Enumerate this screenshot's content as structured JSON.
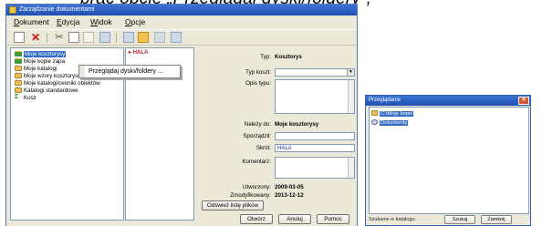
{
  "heading": "brać opcję „Przeglądaj dyski/foldery”,",
  "main_window": {
    "title": "Zarządzanie dokumentami",
    "menu": [
      "Dokument",
      "Edycja",
      "Widok",
      "Opcje"
    ],
    "tree": {
      "items": [
        {
          "label": "Moje kosztorysy",
          "icon": "green-folder-icon",
          "selected": true
        },
        {
          "label": "Moje kopie zapa",
          "icon": "green-folder-icon",
          "selected": false
        },
        {
          "label": "Moje katalogi",
          "icon": "folder-icon",
          "selected": false
        },
        {
          "label": "Moje wzory kosztorysów",
          "icon": "folder-icon",
          "selected": false
        },
        {
          "label": "Moje katalogi/cenniki obiektów",
          "icon": "folder-icon",
          "selected": false
        },
        {
          "label": "Katalogi standardowe",
          "icon": "folder-icon",
          "selected": false
        },
        {
          "label": "Kosz",
          "icon": "sum-icon",
          "selected": false
        }
      ]
    },
    "context_menu": {
      "item": "Przeglądaj dyski/foldery ..."
    },
    "mid_pane_item": "HALA",
    "props": {
      "typ_label": "Typ:",
      "typ_value": "Kosztorys",
      "typ_koszt_label": "Typ koszt:",
      "opis_label": "Opis typu:",
      "nalezy_label": "Należy do:",
      "nalezy_value": "Moje kosztorysy",
      "sporzadzil_label": "Sporządził:",
      "skrot_label": "Skrót:",
      "skrot_value": "HALA",
      "komentarz_label": "Komentarz:",
      "utworzony_label": "Utworzony:",
      "utworzony_value": "2009-03-05",
      "zmodyfikowany_label": "Zmodyfikowany:",
      "zmodyfikowany_value": "2013-12-12",
      "refresh_button": "Odśwież listę plików"
    },
    "buttons": {
      "ok": "Otwórz",
      "cancel": "Anuluj",
      "help": "Pomoc"
    }
  },
  "browse_window": {
    "title": "Przeglądanie",
    "items": [
      {
        "label": "C:\\Moje kopie",
        "icon": "folder-icon"
      },
      {
        "label": "Dokumenty",
        "icon": "drive-icon"
      }
    ],
    "status": "Szukanie w katalogu:",
    "button1": "Szukaj",
    "button2": "Zamknij"
  },
  "colors": {
    "accent": "#316ac5",
    "title_bar": "#1f4fb0",
    "window_bg": "#ece9d8"
  }
}
